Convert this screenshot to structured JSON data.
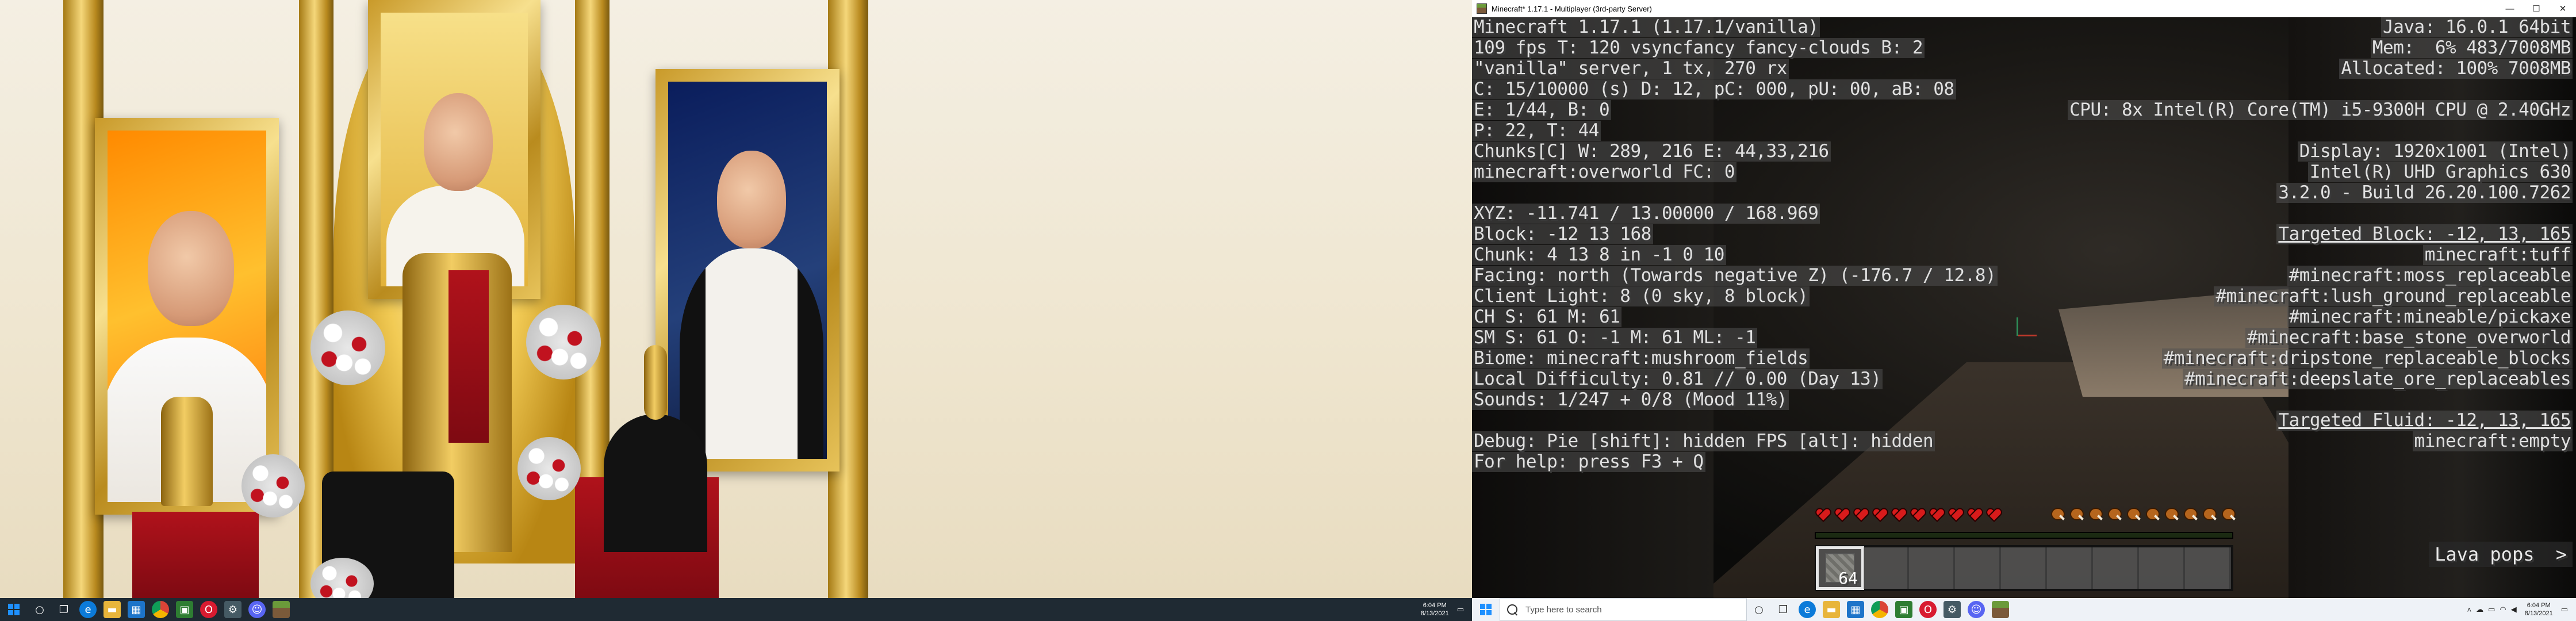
{
  "left_monitor": {
    "taskbar": {
      "icons": [
        "start-icon",
        "search-icon",
        "task-view-icon",
        "widgets-icon",
        "edge-icon",
        "file-explorer-icon",
        "store-icon",
        "chrome-icon",
        "app-icon",
        "opera-icon",
        "app2-icon",
        "discord-icon",
        "minecraft-icon"
      ],
      "clock_time": "6:04 PM",
      "clock_date": "8/13/2021"
    }
  },
  "minecraft": {
    "window_title": "Minecraft* 1.17.1 - Multiplayer (3rd-party Server)",
    "controls": {
      "minimize": "—",
      "maximize": "☐",
      "close": "✕"
    },
    "debug_left": [
      "Minecraft 1.17.1 (1.17.1/vanilla)",
      "109 fps T: 120 vsyncfancy fancy-clouds B: 2",
      "\"vanilla\" server, 1 tx, 270 rx",
      "C: 15/10000 (s) D: 12, pC: 000, pU: 00, aB: 08",
      "E: 1/44, B: 0",
      "P: 22, T: 44",
      "Chunks[C] W: 289, 216 E: 44,33,216",
      "minecraft:overworld FC: 0",
      "",
      "XYZ: -11.741 / 13.00000 / 168.969",
      "Block: -12 13 168",
      "Chunk: 4 13 8 in -1 0 10",
      "Facing: north (Towards negative Z) (-176.7 / 12.8)",
      "Client Light: 8 (0 sky, 8 block)",
      "CH S: 61 M: 61",
      "SM S: 61 O: -1 M: 61 ML: -1",
      "Biome: minecraft:mushroom_fields",
      "Local Difficulty: 0.81 // 0.00 (Day 13)",
      "Sounds: 1/247 + 0/8 (Mood 11%)",
      "",
      "Debug: Pie [shift]: hidden FPS [alt]: hidden",
      "For help: press F3 + Q"
    ],
    "debug_right": [
      "Java: 16.0.1 64bit",
      "Mem:  6% 483/7008MB",
      "Allocated: 100% 7008MB",
      "",
      "CPU: 8x Intel(R) Core(TM) i5-9300H CPU @ 2.40GHz",
      "",
      "Display: 1920x1001 (Intel)",
      "Intel(R) UHD Graphics 630",
      "3.2.0 - Build 26.20.100.7262",
      "",
      "Targeted Block: -12, 13, 165",
      "minecraft:tuff",
      "#minecraft:moss_replaceable",
      "#minecraft:lush_ground_replaceable",
      "#minecraft:mineable/pickaxe",
      "#minecraft:base_stone_overworld",
      "#minecraft:dripstone_replaceable_blocks",
      "#minecraft:deepslate_ore_replaceables",
      "",
      "Targeted Fluid: -12, 13, 165",
      "minecraft:empty"
    ],
    "underlined_right_rows": [
      10,
      19
    ],
    "subtitle": "Lava pops",
    "subtitle_arrow": ">",
    "hud": {
      "hearts_filled": 10,
      "food_filled": 10,
      "xp_progress": 0.0,
      "hotbar_selected_slot": 1,
      "hotbar_slots": 9,
      "hotbar_item_count": "64"
    },
    "taskbar": {
      "search_placeholder": "Type here to search",
      "clock_time": "6:04 PM",
      "clock_date": "8/13/2021"
    }
  },
  "colors": {
    "debug_text": "#e0e0e0",
    "debug_bg": "rgba(80,80,80,0.55)",
    "heart": "#d81b1b",
    "taskbar_dark": "#1f2a33",
    "taskbar_light": "#eef2f7"
  }
}
